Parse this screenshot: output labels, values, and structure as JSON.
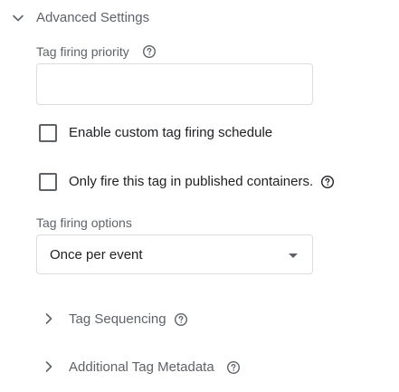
{
  "advanced_settings": {
    "title": "Advanced Settings",
    "expanded": true
  },
  "tag_firing_priority": {
    "label": "Tag firing priority",
    "value": "",
    "help_icon": "help-circle-icon"
  },
  "checkboxes": [
    {
      "label": "Enable custom tag firing schedule",
      "checked": false
    },
    {
      "label": "Only fire this tag in published containers.",
      "checked": false,
      "help_icon": "help-circle-icon"
    }
  ],
  "tag_firing_options": {
    "label": "Tag firing options",
    "selected": "Once per event"
  },
  "expanders": [
    {
      "label": "Tag Sequencing",
      "expanded": false,
      "help_icon": "help-circle-icon"
    },
    {
      "label": "Additional Tag Metadata",
      "expanded": false,
      "help_icon": "help-circle-icon"
    }
  ],
  "colors": {
    "text_primary": "#202124",
    "text_secondary": "#5f6368",
    "border": "#dadce0"
  }
}
